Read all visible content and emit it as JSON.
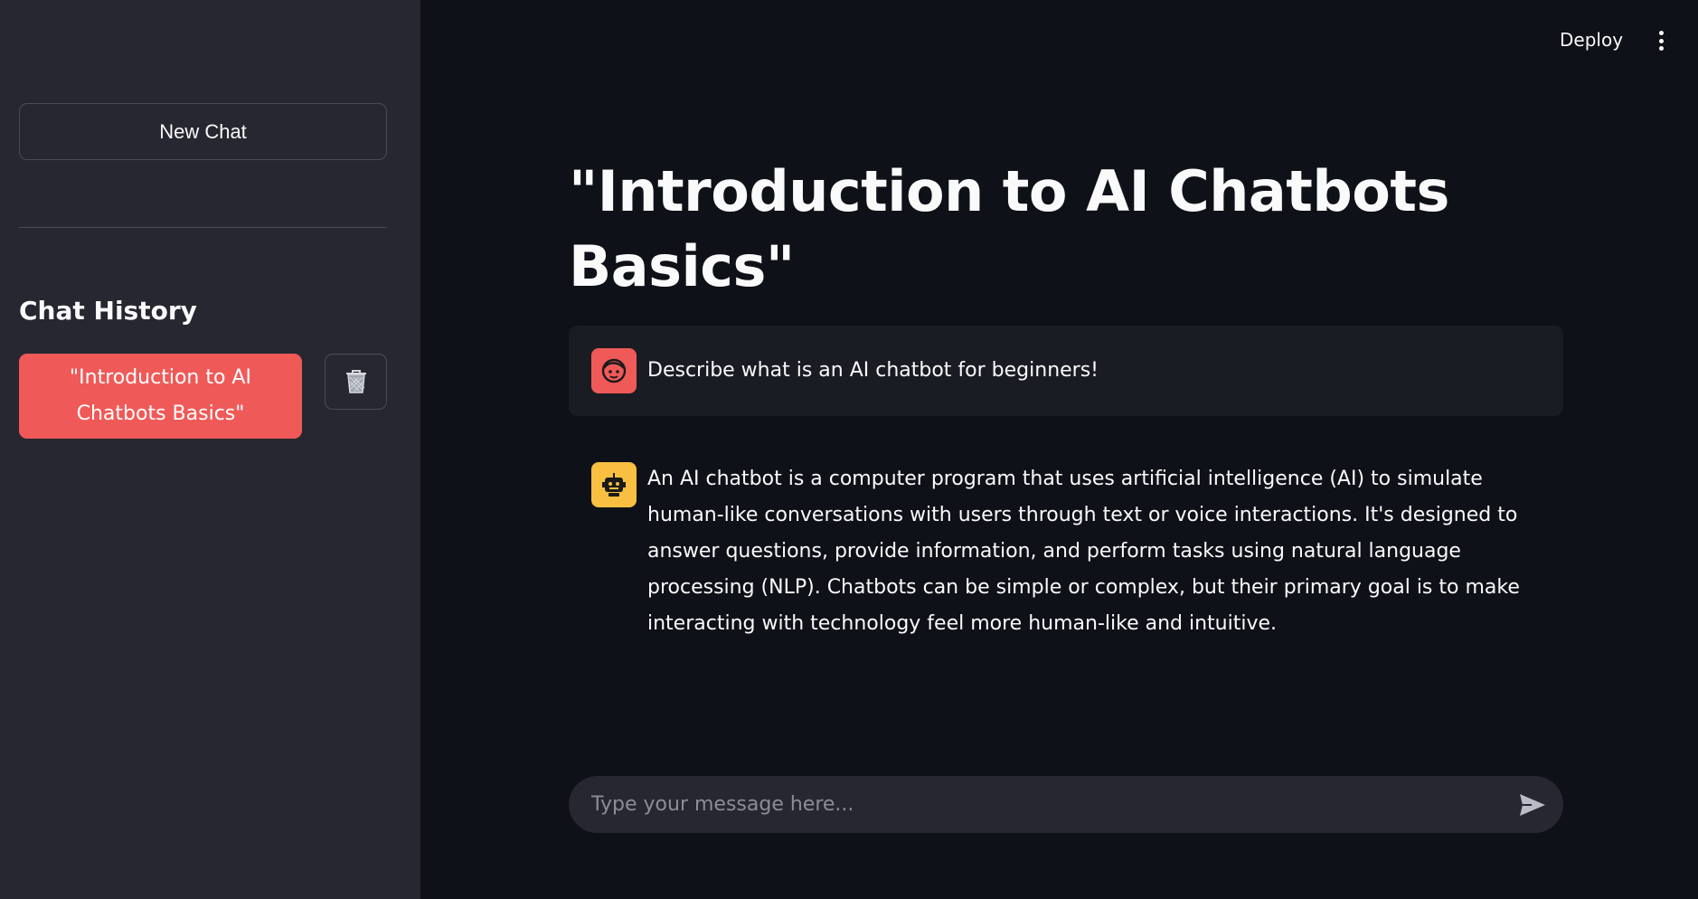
{
  "sidebar": {
    "new_chat_label": "New Chat",
    "history_title": "Chat History",
    "history_items": [
      {
        "label": "\"Introduction to AI Chatbots Basics\""
      }
    ],
    "delete_icon": "trash-icon"
  },
  "header": {
    "deploy_label": "Deploy",
    "menu_icon": "kebab-menu-icon"
  },
  "main": {
    "title": "\"Introduction to AI Chatbots Basics\"",
    "messages": [
      {
        "role": "user",
        "avatar_icon": "user-face-icon",
        "avatar_color": "#ef5a58",
        "text": "Describe what is an AI chatbot for beginners!"
      },
      {
        "role": "assistant",
        "avatar_icon": "robot-icon",
        "avatar_color": "#f9bf41",
        "text": "An AI chatbot is a computer program that uses artificial intelligence (AI) to simulate human-like conversations with users through text or voice interactions. It's designed to answer questions, provide information, and perform tasks using natural language processing (NLP). Chatbots can be simple or complex, but their primary goal is to make interacting with technology feel more human-like and intuitive."
      }
    ],
    "input": {
      "placeholder": "Type your message here...",
      "value": "",
      "send_icon": "send-icon"
    }
  },
  "colors": {
    "sidebar_bg": "#262730",
    "main_bg": "#0e1117",
    "accent": "#ef5a58",
    "bot_avatar": "#f9bf41"
  }
}
